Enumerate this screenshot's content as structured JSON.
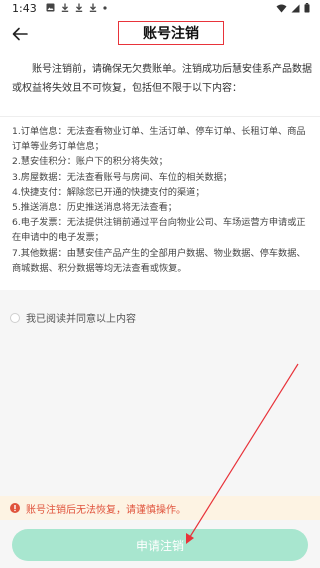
{
  "status_bar": {
    "time": "1:43",
    "left_icons": [
      "image-icon",
      "download-icon",
      "download-icon",
      "download-icon",
      "dot-icon"
    ],
    "right_icons": [
      "wifi-icon",
      "signal-icon",
      "battery-icon"
    ]
  },
  "header": {
    "title": "账号注销",
    "back_icon": "arrow-left-icon"
  },
  "intro": "账号注销前，请确保无欠费账单。注销成功后慧安佳系产品数据或权益将失效且不可恢复，包括但不限于以下内容：",
  "items": [
    "1.订单信息：无法查看物业订单、生活订单、停车订单、长租订单、商品订单等业务订单信息；",
    "2.慧安佳积分：账户下的积分将失效；",
    "3.房屋数据：无法查看账号与房间、车位的相关数据；",
    "4.快捷支付：解除您已开通的快捷支付的渠道；",
    "5.推送消息：历史推送消息将无法查看；",
    "6.电子发票：无法提供注销前通过平台向物业公司、车场运营方申请或正在申请中的电子发票；",
    "7.其他数据：由慧安佳产品产生的全部用户数据、物业数据、停车数据、商城数据、积分数据等均无法查看或恢复。"
  ],
  "agree": {
    "label": "我已阅读并同意以上内容",
    "checked": false
  },
  "warning": {
    "icon": "alert-circle-icon",
    "text": "账号注销后无法恢复，请谨慎操作。",
    "color": "#e0533c"
  },
  "submit": {
    "label": "申请注销",
    "color": "#a8e6cf"
  },
  "colors": {
    "annotation_red": "#e8333a"
  }
}
